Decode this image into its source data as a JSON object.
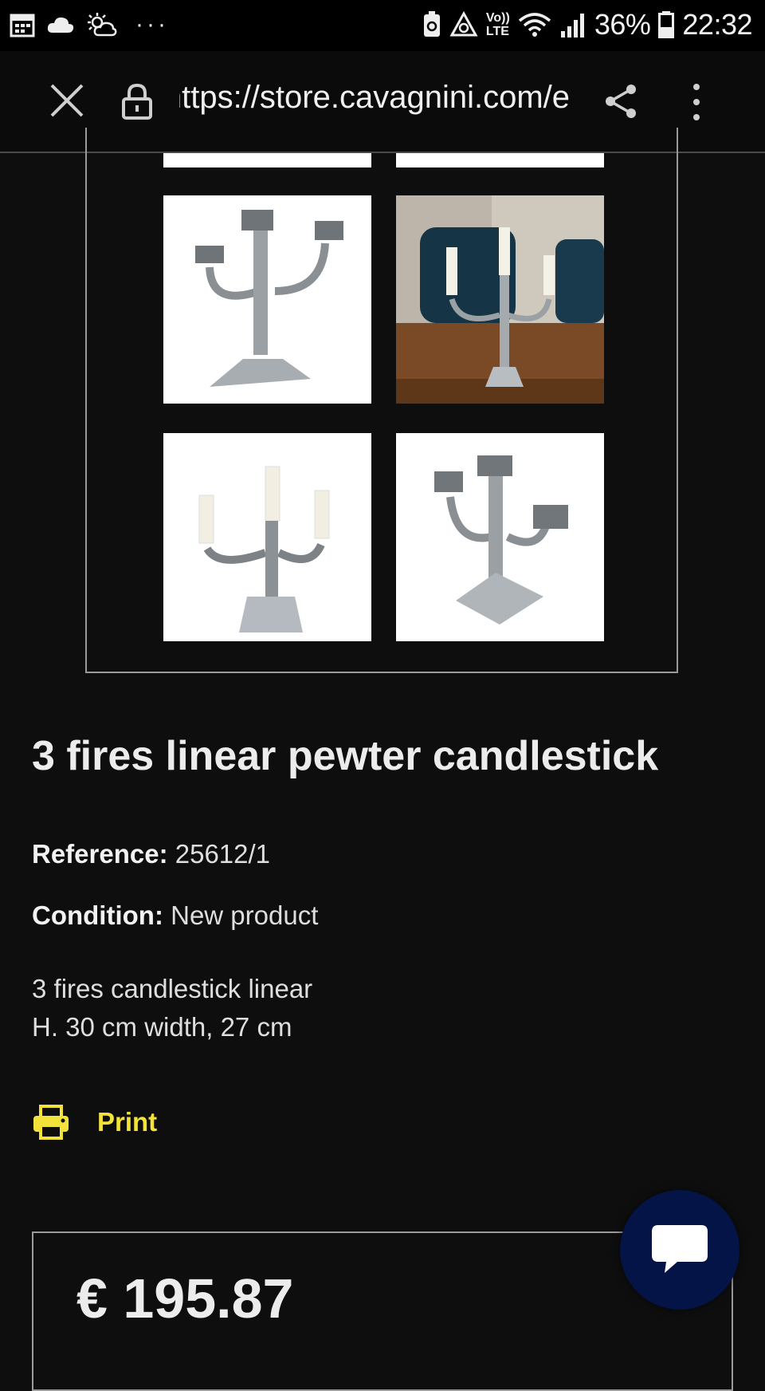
{
  "status_bar": {
    "battery_percent": "36%",
    "time": "22:32",
    "network_label_top": "Vo))",
    "network_label_bottom": "LTE",
    "overflow": "···"
  },
  "url_bar": {
    "url": "https://store.cavagnini.com/e"
  },
  "gallery": {
    "images": [
      "candlestick-front-view",
      "candlestick-on-table-with-candles",
      "candlestick-with-candles",
      "candlestick-angled-view"
    ]
  },
  "product": {
    "title": "3 fires linear pewter candlestick",
    "reference_label": "Reference:",
    "reference_value": "25612/1",
    "condition_label": "Condition:",
    "condition_value": "New product",
    "description_line1": "3 fires candlestick linear",
    "description_line2": "H. 30 cm width, 27 cm"
  },
  "actions": {
    "print_label": "Print"
  },
  "price": {
    "value": "€ 195.87"
  },
  "colors": {
    "background": "#0e0e0e",
    "accent_yellow": "#f2e23a",
    "chat_button": "#041446"
  }
}
